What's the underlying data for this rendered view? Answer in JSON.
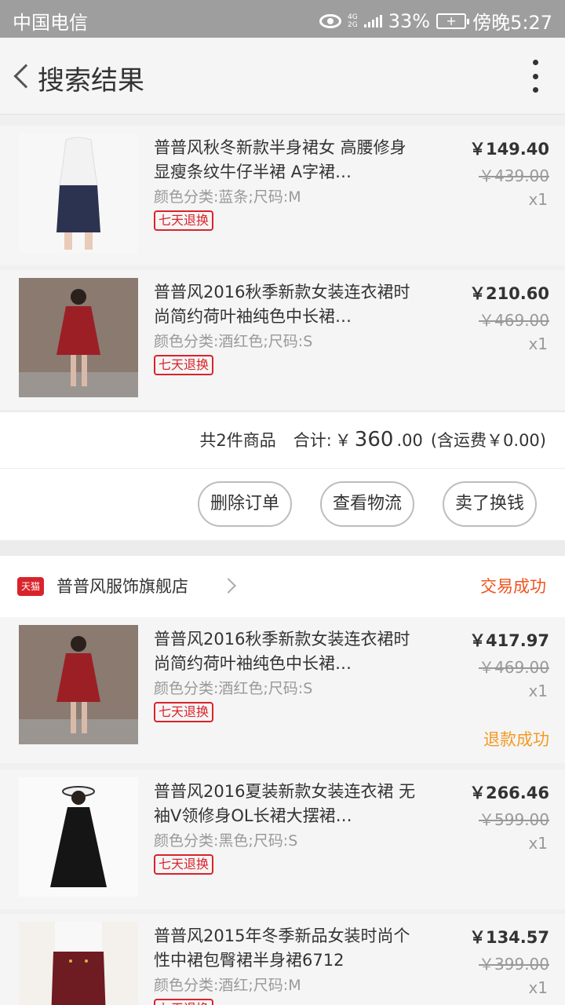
{
  "status_bar": {
    "carrier": "中国电信",
    "network_top": "4G",
    "network_bottom": "2G",
    "battery": "33%",
    "time": "傍晚5:27"
  },
  "header": {
    "title": "搜索结果"
  },
  "order1": {
    "items": [
      {
        "name": "普普风秋冬新款半身裙女 高腰修身显瘦条纹牛仔半裙 A字裙…",
        "spec": "颜色分类:蓝条;尺码:M",
        "tag": "七天退换",
        "price": "￥149.40",
        "original_price": "￥439.00",
        "qty": "x1"
      },
      {
        "name": "普普风2016秋季新款女装连衣裙时尚简约荷叶袖纯色中长裙…",
        "spec": "颜色分类:酒红色;尺码:S",
        "tag": "七天退换",
        "price": "￥210.60",
        "original_price": "￥469.00",
        "qty": "x1"
      }
    ],
    "summary": {
      "count": "共2件商品",
      "total_label": "合计:",
      "total_currency": "￥",
      "total_int": "360",
      "total_dec": ".00",
      "shipping": "(含运费￥0.00)"
    },
    "actions": {
      "delete": "删除订单",
      "logistics": "查看物流",
      "sell": "卖了换钱"
    }
  },
  "order2": {
    "store": {
      "badge": "天猫",
      "name": "普普风服饰旗舰店",
      "status": "交易成功"
    },
    "items": [
      {
        "name": "普普风2016秋季新款女装连衣裙时尚简约荷叶袖纯色中长裙…",
        "spec": "颜色分类:酒红色;尺码:S",
        "tag": "七天退换",
        "price": "￥417.97",
        "original_price": "￥469.00",
        "qty": "x1",
        "refund": "退款成功"
      },
      {
        "name": "普普风2016夏装新款女装连衣裙  无袖V领修身OL长裙大摆裙…",
        "spec": "颜色分类:黑色;尺码:S",
        "tag": "七天退换",
        "price": "￥266.46",
        "original_price": "￥599.00",
        "qty": "x1"
      },
      {
        "name": "普普风2015年冬季新品女装时尚个性中裙包臀裙半身裙6712",
        "spec": "颜色分类:酒红;尺码:M",
        "tag": "七天退换",
        "price": "￥134.57",
        "original_price": "￥399.00",
        "qty": "x1"
      }
    ]
  },
  "colors": {
    "accent_red": "#d9232b",
    "status_orange": "#f0541e",
    "refund_orange": "#f39a23"
  }
}
